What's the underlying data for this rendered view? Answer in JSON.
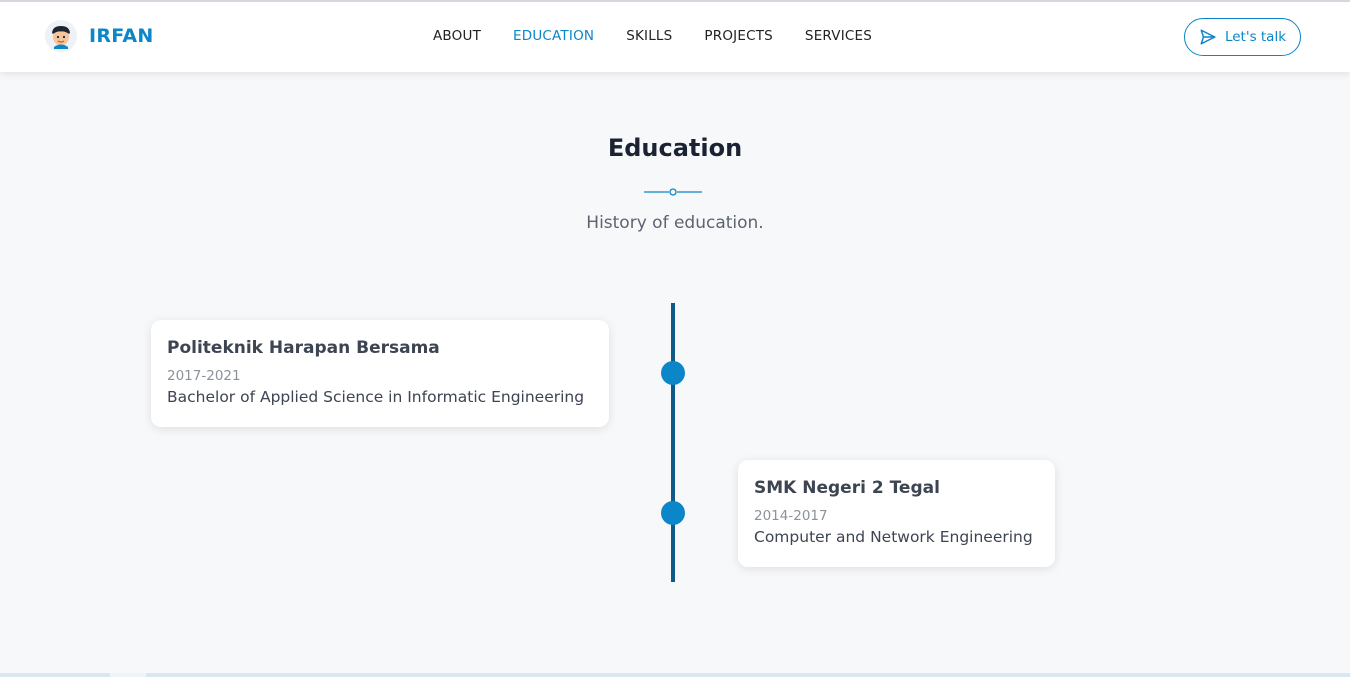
{
  "header": {
    "brand_name": "IRFAN",
    "nav": [
      {
        "label": "ABOUT",
        "active": false
      },
      {
        "label": "EDUCATION",
        "active": true
      },
      {
        "label": "SKILLS",
        "active": false
      },
      {
        "label": "PROJECTS",
        "active": false
      },
      {
        "label": "SERVICES",
        "active": false
      }
    ],
    "cta_label": "Let's talk",
    "cta_icon": "send-icon"
  },
  "section": {
    "title": "Education",
    "subtitle": "History of education."
  },
  "timeline": [
    {
      "school": "Politeknik Harapan Bersama",
      "years": "2017-2021",
      "degree": "Bachelor of Applied Science in Informatic Engineering",
      "side": "left"
    },
    {
      "school": "SMK Negeri 2 Tegal",
      "years": "2014-2017",
      "degree": "Computer and Network Engineering",
      "side": "right"
    }
  ],
  "colors": {
    "accent": "#0b86c8",
    "timeline_line": "#0f5a86",
    "background": "#f7f8fa"
  }
}
